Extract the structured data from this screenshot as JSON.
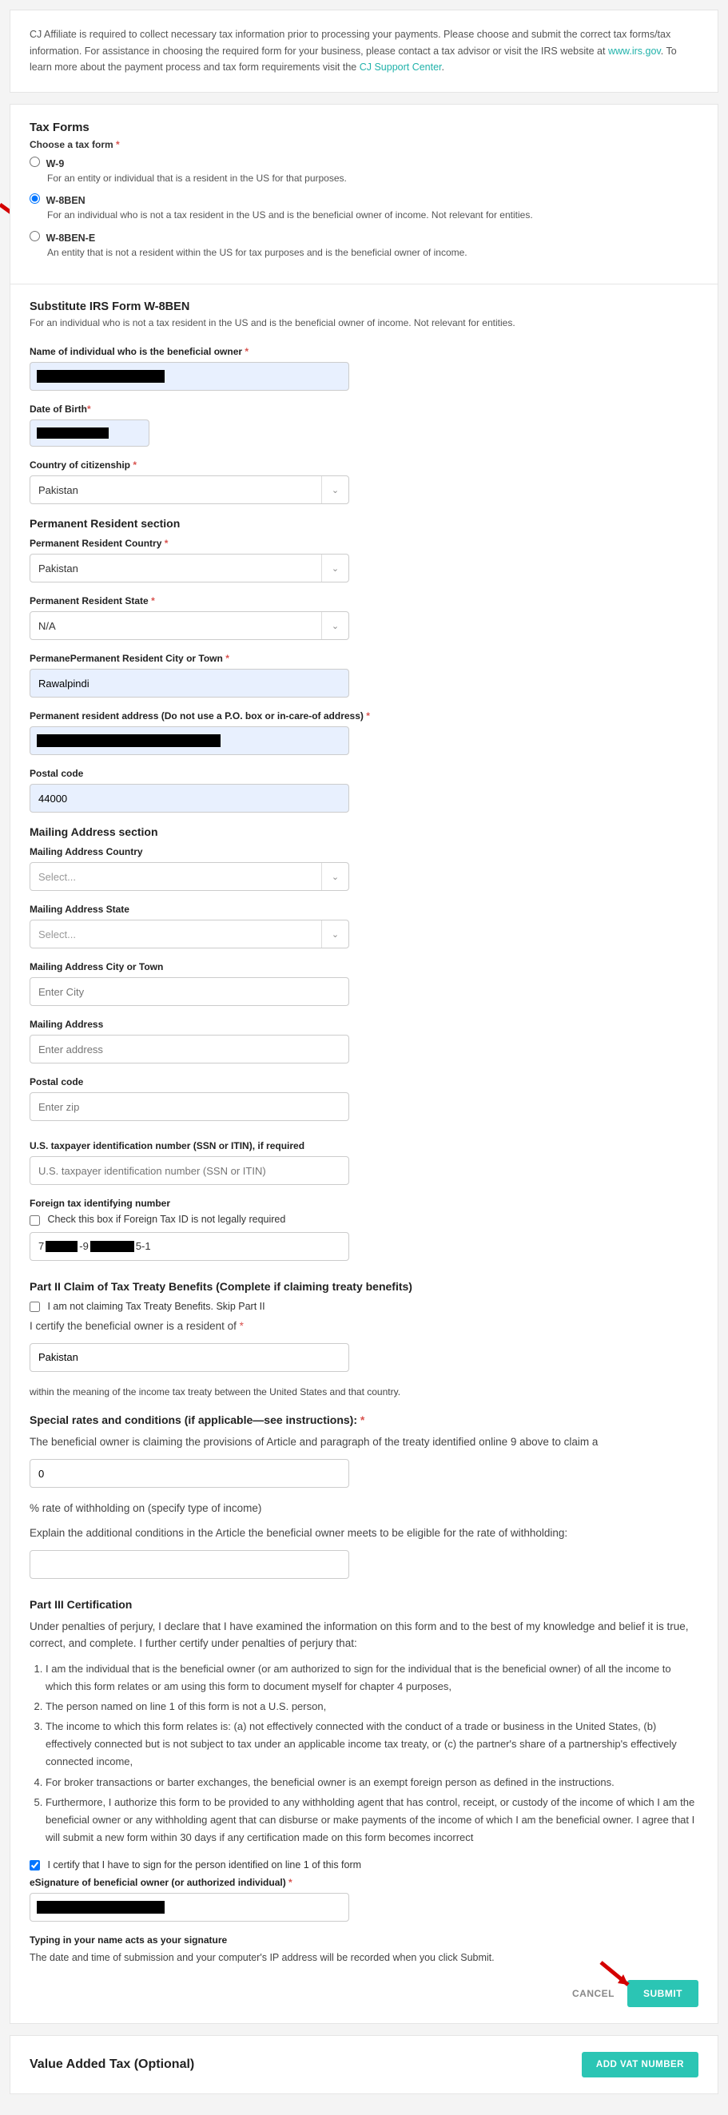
{
  "intro": {
    "text1": "CJ Affiliate is required to collect necessary tax information prior to processing your payments. Please choose and submit the correct tax forms/tax information. For assistance in choosing the required form for your business, please contact a tax advisor or visit the IRS website at ",
    "link1": "www.irs.gov",
    "text2": ". To learn more about the payment process and tax form requirements visit the ",
    "link2": "CJ Support Center",
    "text3": "."
  },
  "taxForms": {
    "title": "Tax Forms",
    "chooseLabel": "Choose a tax form",
    "options": {
      "w9": {
        "label": "W-9",
        "desc": "For an entity or individual that is a resident in the US for that purposes."
      },
      "w8ben": {
        "label": "W-8BEN",
        "desc": "For an individual who is not a tax resident in the US and is the beneficial owner of income. Not relevant for entities."
      },
      "w8bene": {
        "label": "W-8BEN-E",
        "desc": "An entity that is not a resident within the US for tax purposes and is the beneficial owner of income."
      }
    }
  },
  "form": {
    "heading": "Substitute IRS Form W-8BEN",
    "headingDesc": "For an individual who is not a tax resident in the US and is the beneficial owner of income. Not relevant for entities.",
    "nameLabel": "Name of individual who is the beneficial owner",
    "dobLabel": "Date of Birth",
    "citizenLabel": "Country of citizenship",
    "citizenValue": "Pakistan",
    "permSection": "Permanent Resident section",
    "permCountryLabel": "Permanent Resident Country",
    "permCountryValue": "Pakistan",
    "permStateLabel": "Permanent Resident State",
    "permStateValue": "N/A",
    "permCityLabel": "PermanePermanent Resident City or Town",
    "permCityValue": "Rawalpindi",
    "permAddrLabel": "Permanent resident address (Do not use a P.O. box or in-care-of address)",
    "postalLabel": "Postal code",
    "postalValue": "44000",
    "mailSection": "Mailing Address section",
    "mailCountryLabel": "Mailing Address Country",
    "mailCountryPh": "Select...",
    "mailStateLabel": "Mailing Address State",
    "mailStatePh": "Select...",
    "mailCityLabel": "Mailing Address City or Town",
    "mailCityPh": "Enter City",
    "mailAddrLabel": "Mailing Address",
    "mailAddrPh": "Enter address",
    "mailPostalLabel": "Postal code",
    "mailPostalPh": "Enter zip",
    "usTinLabel": "U.S. taxpayer identification number (SSN or ITIN), if required",
    "usTinPh": "U.S. taxpayer identification number (SSN or ITIN)",
    "ftinLabel": "Foreign tax identifying number",
    "ftinCheck": "Check this box if Foreign Tax ID is not legally required",
    "part2": {
      "title": "Part II Claim of Tax Treaty Benefits (Complete if claiming treaty benefits)",
      "skipCheck": "I am not claiming Tax Treaty Benefits. Skip Part II",
      "certText": "I certify the beneficial owner is a resident of",
      "residentValue": "Pakistan",
      "withinText": "within the meaning of the income tax treaty between the United States and that country.",
      "specialTitle": "Special rates and conditions (if applicable—see instructions):",
      "claimText": "The beneficial owner is claiming the provisions of Article and paragraph of the treaty identified online 9 above to claim a",
      "rateValue": "0",
      "rateText": "% rate of withholding on (specify type of income)",
      "explainText": "Explain the additional conditions in the Article the beneficial owner meets to be eligible for the rate of withholding:"
    },
    "part3": {
      "title": "Part III Certification",
      "intro": "Under penalties of perjury, I declare that I have examined the information on this form and to the best of my knowledge and belief it is true, correct, and complete. I further certify under penalties of perjury that:",
      "items": [
        "I am the individual that is the beneficial owner (or am authorized to sign for the individual that is the beneficial owner) of all the income to which this form relates or am using this form to document myself for chapter 4 purposes,",
        "The person named on line 1 of this form is not a U.S. person,",
        "The income to which this form relates is: (a) not effectively connected with the conduct of a trade or business in the United States, (b) effectively connected but is not subject to tax under an applicable income tax treaty, or (c) the partner's share of a partnership's effectively connected income,",
        "For broker transactions or barter exchanges, the beneficial owner is an exempt foreign person as defined in the instructions.",
        "Furthermore, I authorize this form to be provided to any withholding agent that has control, receipt, or custody of the income of which I am the beneficial owner or any withholding agent that can disburse or make payments of the income of which I am the beneficial owner. I agree that I will submit a new form within 30 days if any certification made on this form becomes incorrect"
      ],
      "certCheck": "I certify that I have to sign for the person identified on line 1 of this form",
      "sigLabel": "eSignature of beneficial owner (or authorized individual)",
      "typingNote": "Typing in your name acts as your signature",
      "ipNote": "The date and time of submission and your computer's IP address will be recorded when you click Submit."
    },
    "cancelBtn": "CANCEL",
    "submitBtn": "SUBMIT"
  },
  "vat": {
    "title": "Value Added Tax (Optional)",
    "btn": "ADD VAT NUMBER"
  }
}
